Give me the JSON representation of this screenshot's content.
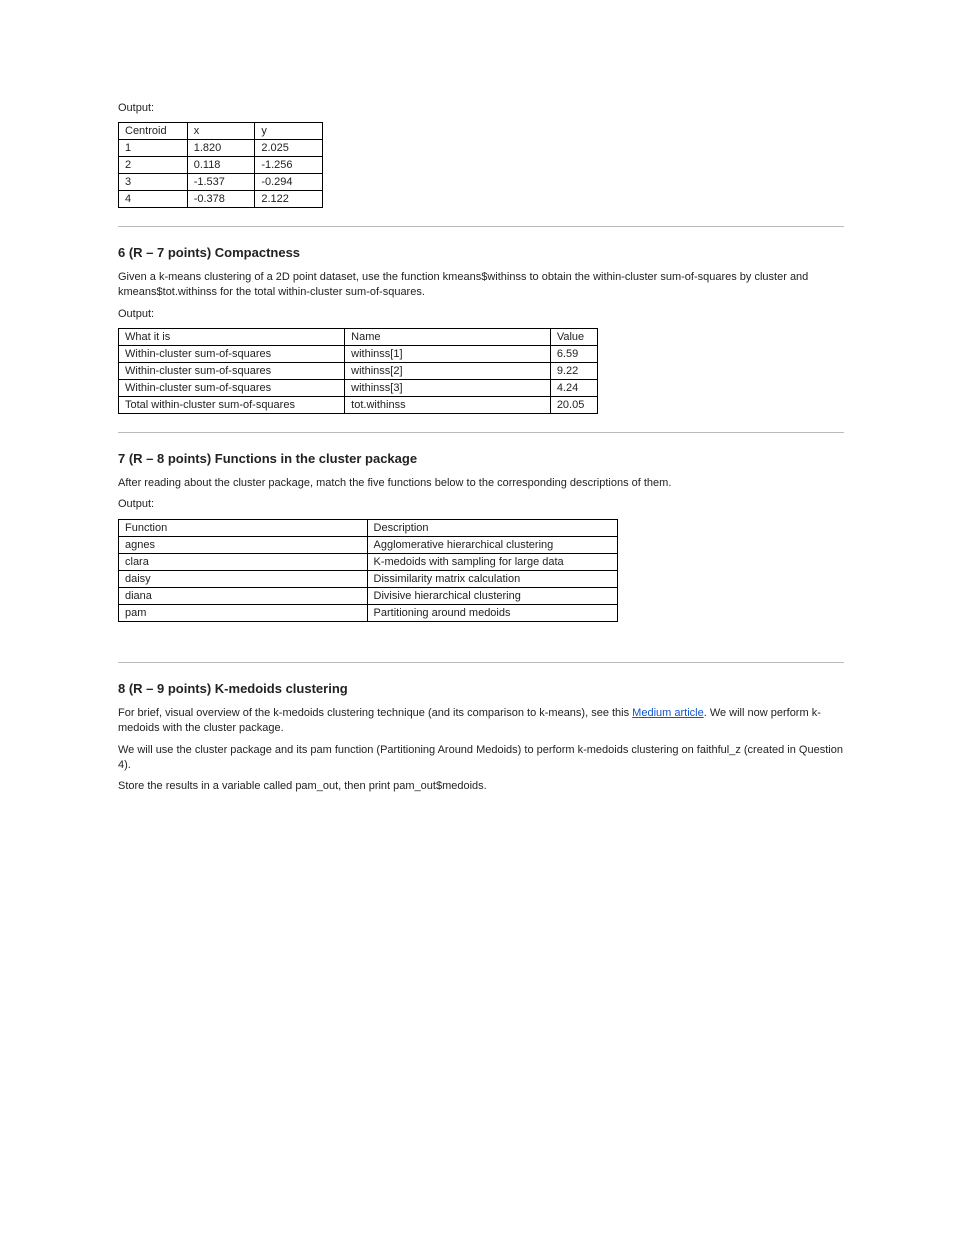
{
  "section1": {
    "label": "Output:",
    "table": {
      "headers": [
        "Centroid",
        "x",
        "y"
      ],
      "rows": [
        [
          "1",
          "1.820",
          "2.025"
        ],
        [
          "2",
          "0.118",
          "-1.256"
        ],
        [
          "3",
          "-1.537",
          "-0.294"
        ],
        [
          "4",
          "-0.378",
          "2.122"
        ]
      ]
    }
  },
  "section2": {
    "heading": "6 (R – 7 points) Compactness",
    "intro": "Given a k-means clustering of a 2D point dataset, use the function kmeans$withinss to obtain the within-cluster sum-of-squares by cluster and kmeans$tot.withinss for the total within-cluster sum-of-squares.",
    "output_label": "Output:",
    "table": {
      "headers": [
        "What it is",
        "Name",
        "Value"
      ],
      "rows": [
        [
          "Within-cluster sum-of-squares",
          "withinss[1]",
          "6.59"
        ],
        [
          "Within-cluster sum-of-squares",
          "withinss[2]",
          "9.22"
        ],
        [
          "Within-cluster sum-of-squares",
          "withinss[3]",
          "4.24"
        ],
        [
          "Total within-cluster sum-of-squares",
          "tot.withinss",
          "20.05"
        ]
      ]
    }
  },
  "section3": {
    "heading": "7 (R – 8 points) Functions in the cluster package",
    "intro": "After reading about the cluster package, match the five functions below to the corresponding descriptions of them.",
    "output_label": "Output:",
    "table": {
      "headers": [
        "Function",
        "Description"
      ],
      "rows": [
        [
          "agnes",
          "Agglomerative hierarchical clustering"
        ],
        [
          "clara",
          "K-medoids with sampling for large data"
        ],
        [
          "daisy",
          "Dissimilarity matrix calculation"
        ],
        [
          "diana",
          "Divisive hierarchical clustering"
        ],
        [
          "pam",
          "Partitioning around medoids"
        ]
      ]
    }
  },
  "section4": {
    "heading": "8 (R – 9 points) K-medoids clustering",
    "intro_prefix": "For brief, visual overview of the k-medoids clustering technique (and its comparison to k-means), see this ",
    "link_text": "Medium article",
    "intro_suffix": ". We will now perform k-medoids with the cluster package.",
    "lines": [
      "We will use the cluster package and its pam function (Partitioning Around Medoids) to perform k-medoids clustering on faithful_z (created in Question 4).",
      "Store the results in a variable called pam_out, then print pam_out$medoids."
    ]
  }
}
